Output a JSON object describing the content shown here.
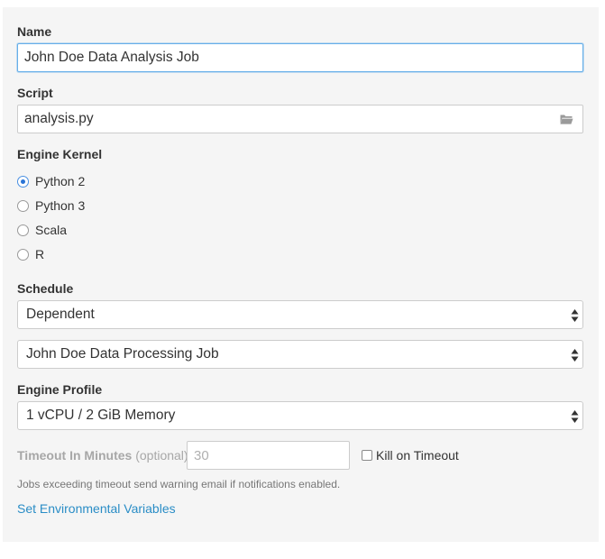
{
  "form": {
    "name": {
      "label": "Name",
      "value": "John Doe Data Analysis Job"
    },
    "script": {
      "label": "Script",
      "value": "analysis.py",
      "icon": "folder-icon"
    },
    "engine_kernel": {
      "label": "Engine Kernel",
      "options": [
        "Python 2",
        "Python 3",
        "Scala",
        "R"
      ],
      "selected": "Python 2"
    },
    "schedule": {
      "label": "Schedule",
      "value": "Dependent",
      "dependency_value": "John Doe Data Processing Job"
    },
    "engine_profile": {
      "label": "Engine Profile",
      "value": "1 vCPU / 2 GiB Memory"
    },
    "timeout": {
      "label": "Timeout In Minutes",
      "optional": "(optional)",
      "placeholder": "30",
      "kill_label": "Kill on Timeout",
      "kill_checked": false
    },
    "help_text": "Jobs exceeding timeout send warning email if notifications enabled.",
    "env_link": "Set Environmental Variables"
  },
  "colors": {
    "focus_border": "#66afe9",
    "link": "#2a8dc6",
    "radio_selected": "#2a74d6",
    "panel_bg": "#f5f5f5"
  }
}
